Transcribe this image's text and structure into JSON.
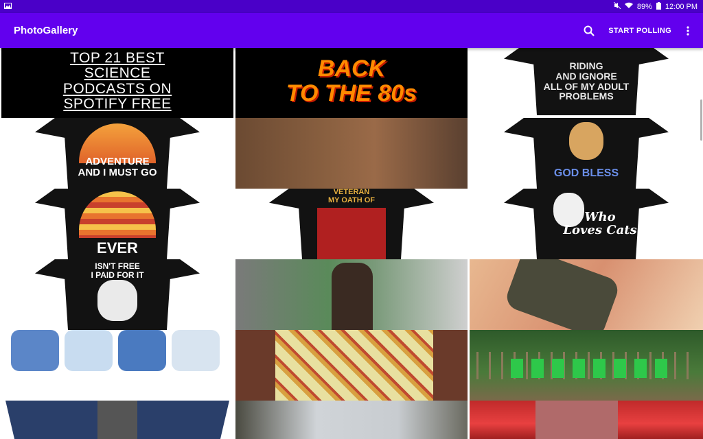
{
  "status_bar": {
    "notification_icon": "image-icon",
    "battery": "89%",
    "time": "12:00 PM",
    "icons": [
      "mute-icon",
      "wifi-icon",
      "battery-icon"
    ]
  },
  "app_bar": {
    "title": "PhotoGallery",
    "search_icon": "search-icon",
    "polling_label": "START POLLING",
    "overflow_icon": "more-vert-icon",
    "color": "#6200ee",
    "status_color": "#4a00c8"
  },
  "gallery": {
    "items": [
      {
        "caption": "TOP 21 BEST\nSCIENCE\nPODCASTS ON\nSPOTIFY FREE",
        "theme": "podcasts"
      },
      {
        "caption": "BACK\nTO THE 80s",
        "theme": "back-to-80s"
      },
      {
        "caption": "RIDING\nAND IGNORE\nALL OF MY ADULT\nPROBLEMS",
        "theme": "riding-shirt"
      },
      {
        "caption": "ADVENTURE\nAND I MUST GO",
        "theme": "adventure-shirt"
      },
      {
        "caption": "",
        "theme": "man-brown-shirt"
      },
      {
        "caption": "GOD BLESS",
        "theme": "dog-shirt"
      },
      {
        "caption": "EVER",
        "theme": "paw-shirt"
      },
      {
        "caption": "VETERAN\nMY OATH OF",
        "theme": "veteran-shirt"
      },
      {
        "caption": "Who\nLoves Cats",
        "theme": "cat-shirt"
      },
      {
        "caption": "ISN'T FREE\nI PAID FOR IT",
        "theme": "eagle-shirt"
      },
      {
        "caption": "",
        "theme": "man-gym-photo"
      },
      {
        "caption": "",
        "theme": "gloves-photo"
      },
      {
        "caption": "",
        "theme": "scrub-tops"
      },
      {
        "caption": "",
        "theme": "fabric-photo"
      },
      {
        "caption": "",
        "theme": "fence-shirts"
      },
      {
        "caption": "",
        "theme": "navy-shirt"
      },
      {
        "caption": "",
        "theme": "grey-shirt-photo"
      },
      {
        "caption": "",
        "theme": "red-car-photo"
      }
    ]
  }
}
